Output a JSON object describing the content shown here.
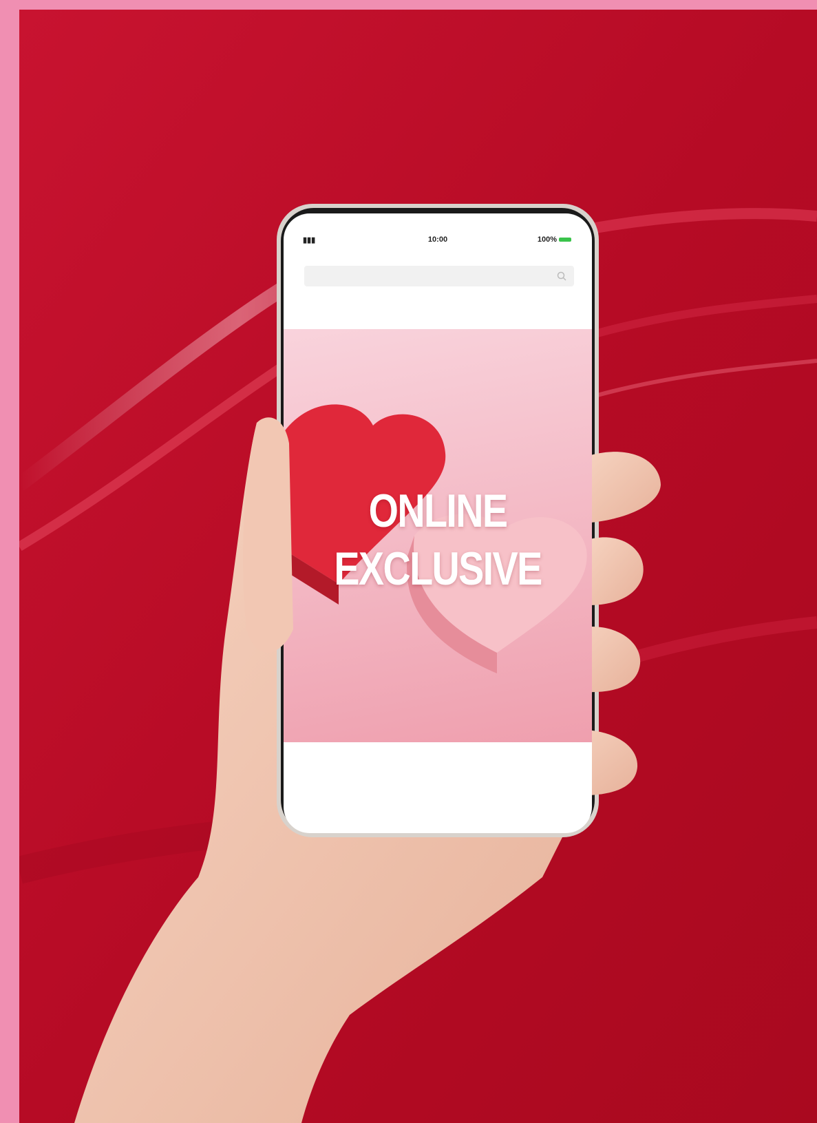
{
  "phone": {
    "status_time": "10:00",
    "battery": "100%",
    "search_icon": "search-icon"
  },
  "banner": {
    "line1": "ONLINE",
    "line2": "EXCLUSIVE"
  },
  "colors": {
    "page_background": "#f08fb2",
    "lipstick_red": "#b80a26",
    "banner_pink": "#f3b7c3",
    "text_white": "#ffffff"
  }
}
